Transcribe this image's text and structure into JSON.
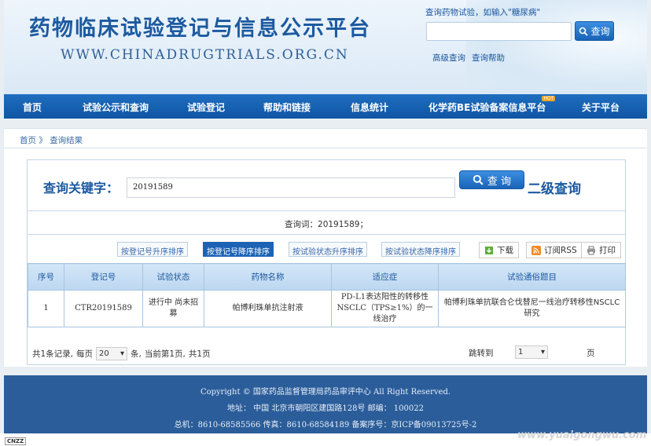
{
  "header": {
    "title": "药物临床试验登记与信息公示平台",
    "url": "WWW.CHINADRUGTRIALS.ORG.CN",
    "search_hint": "查询药物试验，如输入\"糖尿病\"",
    "search_button": "查询",
    "advanced_search": "高级查询",
    "search_help": "查询帮助"
  },
  "nav": {
    "items": [
      "首页",
      "试验公示和查询",
      "试验登记",
      "帮助和链接",
      "信息统计",
      "化学药BE试验备案信息平台",
      "关于平台"
    ],
    "hot_badge": "HOT"
  },
  "breadcrumb": {
    "home": "首页",
    "sep": "》",
    "current": "查询结果"
  },
  "search": {
    "keyword_label": "查询关键字：",
    "keyword_value": "20191589",
    "button": "查 询",
    "second_query": "二级查询"
  },
  "query_line": "查询词：20191589；",
  "sort_buttons": [
    "按登记号升序排序",
    "按登记号降序排序",
    "按试验状态升序排序",
    "按试验状态降序排序"
  ],
  "tools": {
    "download": "下载",
    "rss": "订阅RSS",
    "print": "打印"
  },
  "table": {
    "headers": [
      "序号",
      "登记号",
      "试验状态",
      "药物名称",
      "适应症",
      "试验通俗题目"
    ],
    "rows": [
      {
        "index": "1",
        "reg_no": "CTR20191589",
        "status": "进行中 尚未招募",
        "drug": "帕博利珠单抗注射液",
        "indication": "PD-L1表达阳性的转移性NSCLC（TPS≥1%）的一线治疗",
        "title": "帕博利珠单抗联合仑伐替尼一线治疗转移性NSCLC研究"
      }
    ]
  },
  "pager": {
    "total_prefix": "共1条记录,",
    "per_page_label": "每页",
    "per_page_value": "20",
    "per_page_unit": "条,",
    "current": "当前第1页,",
    "total_pages": "共1页",
    "jump_label": "跳转到",
    "jump_value": "1",
    "page_unit": "页"
  },
  "footer": {
    "copyright": "Copyright © 国家药品监督管理局药品审评中心 All Right Reserved.",
    "address": "地址：  中国 北京市朝阳区建国路128号 邮编：  100022",
    "contact": "总机：8610-68585566 传真：8610-68584189 备案序号：京ICP备09013725号-2"
  },
  "badge": "CNZZ",
  "watermark": "www.yuaigongwu.com",
  "colors": {
    "brand": "#1c5aa0",
    "nav": "#1565b4",
    "footer": "#2b5d9a",
    "active_sort": "#1d63b5"
  }
}
